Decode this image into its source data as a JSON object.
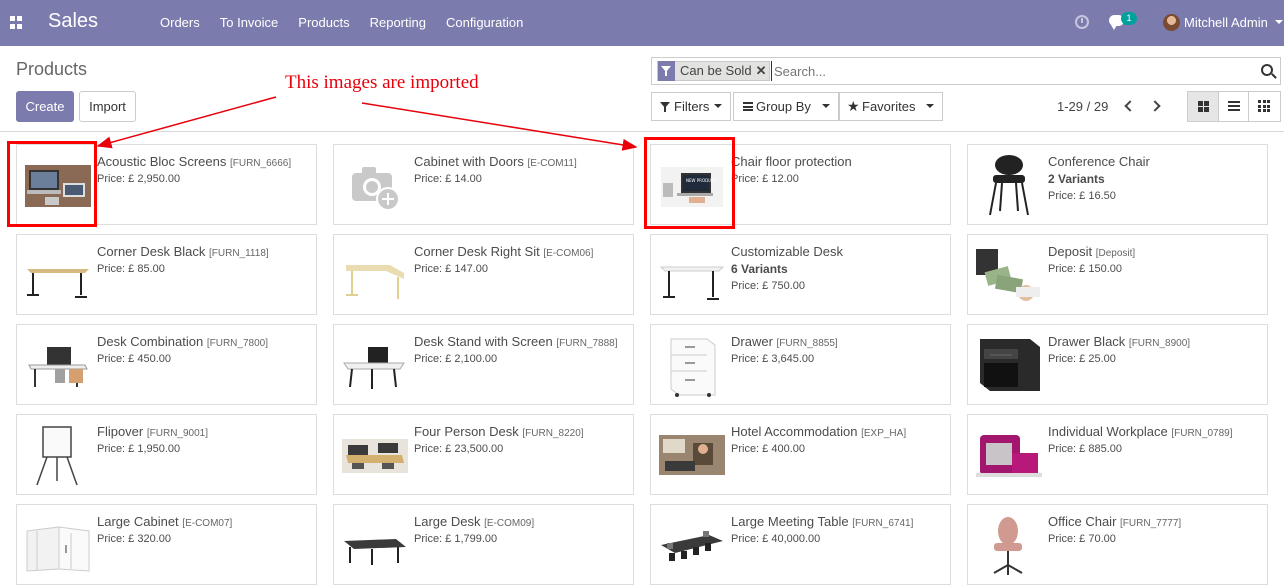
{
  "navbar": {
    "app_name": "Sales",
    "menu": [
      "Orders",
      "To Invoice",
      "Products",
      "Reporting",
      "Configuration"
    ],
    "chat_badge": "1",
    "user_name": "Mitchell Admin"
  },
  "control_panel": {
    "title": "Products",
    "create_label": "Create",
    "import_label": "Import",
    "facet_label": "Can be Sold",
    "search_placeholder": "Search...",
    "filters_label": "Filters",
    "groupby_label": "Group By",
    "favorites_label": "Favorites",
    "pager": "1-29 / 29"
  },
  "annotation": {
    "text": "This images are imported"
  },
  "products": [
    {
      "name": "Acoustic Bloc Screens",
      "ref": "[FURN_6666]",
      "price": "Price: £ 2,950.00",
      "img": "laptop"
    },
    {
      "name": "Cabinet with Doors",
      "ref": "[E-COM11]",
      "price": "Price: £ 14.00",
      "img": "placeholder"
    },
    {
      "name": "Chair floor protection",
      "ref": "",
      "price": "Price: £ 12.00",
      "img": "screen"
    },
    {
      "name": "Conference Chair",
      "ref": "",
      "variants": "2 Variants",
      "price": "Price: £ 16.50",
      "img": "chair-black"
    },
    {
      "name": "Corner Desk Black",
      "ref": "[FURN_1118]",
      "price": "Price: £ 85.00",
      "img": "desk-wood"
    },
    {
      "name": "Corner Desk Right Sit",
      "ref": "[E-COM06]",
      "price": "Price: £ 147.00",
      "img": "desk-corner"
    },
    {
      "name": "Customizable Desk",
      "ref": "",
      "variants": "6 Variants",
      "price": "Price: £ 750.00",
      "img": "desk-white"
    },
    {
      "name": "Deposit",
      "ref": "[Deposit]",
      "price": "Price: £ 150.00",
      "img": "money"
    },
    {
      "name": "Desk Combination",
      "ref": "[FURN_7800]",
      "price": "Price: £ 450.00",
      "img": "desk-combo"
    },
    {
      "name": "Desk Stand with Screen",
      "ref": "[FURN_7888]",
      "price": "Price: £ 2,100.00",
      "img": "desk-stand"
    },
    {
      "name": "Drawer",
      "ref": "[FURN_8855]",
      "price": "Price: £ 3,645.00",
      "img": "drawer-white"
    },
    {
      "name": "Drawer Black",
      "ref": "[FURN_8900]",
      "price": "Price: £ 25.00",
      "img": "drawer-black"
    },
    {
      "name": "Flipover",
      "ref": "[FURN_9001]",
      "price": "Price: £ 1,950.00",
      "img": "flipover"
    },
    {
      "name": "Four Person Desk",
      "ref": "[FURN_8220]",
      "price": "Price: £ 23,500.00",
      "img": "office"
    },
    {
      "name": "Hotel Accommodation",
      "ref": "[EXP_HA]",
      "price": "Price: £ 400.00",
      "img": "hotel"
    },
    {
      "name": "Individual Workplace",
      "ref": "[FURN_0789]",
      "price": "Price: £ 885.00",
      "img": "workplace"
    },
    {
      "name": "Large Cabinet",
      "ref": "[E-COM07]",
      "price": "Price: £ 320.00",
      "img": "cabinet"
    },
    {
      "name": "Large Desk",
      "ref": "[E-COM09]",
      "price": "Price: £ 1,799.00",
      "img": "large-desk"
    },
    {
      "name": "Large Meeting Table",
      "ref": "[FURN_6741]",
      "price": "Price: £ 40,000.00",
      "img": "meeting"
    },
    {
      "name": "Office Chair",
      "ref": "[FURN_7777]",
      "price": "Price: £ 70.00",
      "img": "chair-pink"
    }
  ]
}
